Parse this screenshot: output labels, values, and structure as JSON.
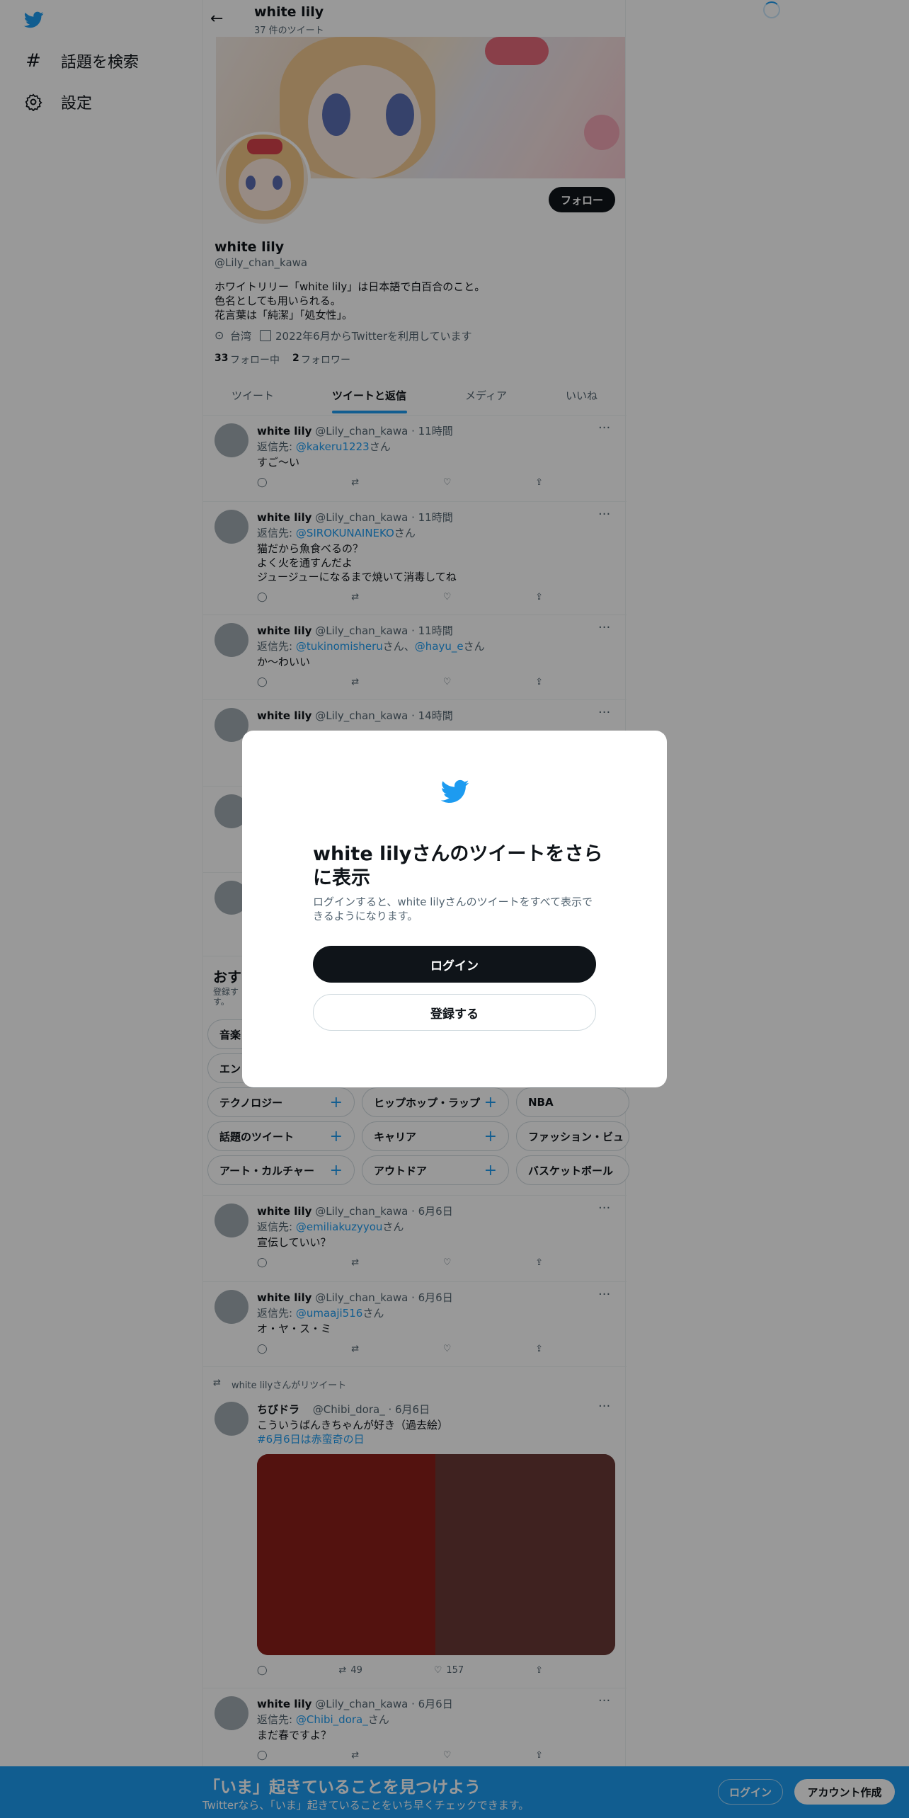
{
  "sidebar": {
    "items": [
      {
        "label": "話題を検索",
        "icon": "hash-icon"
      },
      {
        "label": "設定",
        "icon": "gear-icon"
      }
    ]
  },
  "header": {
    "name": "white lily",
    "count": "37 件のツイート"
  },
  "profile": {
    "name": "white lily",
    "handle": "@Lily_chan_kawa",
    "follow": "フォロー",
    "bio": [
      "ホワイトリリー「white lily」は日本語で白百合のこと。",
      "色名としても用いられる。",
      "花言葉は「純潔」「処女性」。"
    ],
    "location": "台湾",
    "joined": "2022年6月からTwitterを利用しています",
    "following_count": "33",
    "following_label": "フォロー中",
    "followers_count": "2",
    "followers_label": "フォロワー"
  },
  "tabs": [
    "ツイート",
    "ツイートと返信",
    "メディア",
    "いいね"
  ],
  "reply_prefix": "返信先:",
  "reply_suffix": "さん",
  "tweets": [
    {
      "name": "white lily",
      "meta": "@Lily_chan_kawa · 11時間",
      "reply_to": "@kakeru1223",
      "text": [
        "すご～い"
      ]
    },
    {
      "name": "white lily",
      "meta": "@Lily_chan_kawa · 11時間",
      "reply_to": "@SIROKUNAINEKO",
      "text": [
        "猫だから魚食べるの？",
        "よく火を通すんだよ",
        "ジュージューになるまで焼いて消毒してね"
      ]
    },
    {
      "name": "white lily",
      "meta": "@Lily_chan_kawa · 11時間",
      "reply_to": "@tukinomisheru",
      "reply_to2": "@hayu_e",
      "reply_mid": "さん、",
      "text": [
        "か～わいい"
      ]
    },
    {
      "name": "white lily",
      "meta": "@Lily_chan_kawa · 14時間"
    }
  ],
  "recommend": {
    "title": "おす",
    "subtitle1": "登録す",
    "subtitle2": "す。"
  },
  "chips": [
    "音楽",
    "エン",
    "テクノロジー",
    "ヒップホップ・ラップ",
    "NBA",
    "話題のツイート",
    "キャリア",
    "ファッション・ビュ",
    "アート・カルチャー",
    "アウトドア",
    "バスケットボール"
  ],
  "tweets2": [
    {
      "name": "white lily",
      "meta": "@Lily_chan_kawa · 6月6日",
      "reply_to": "@emiliakuzyyou",
      "text": [
        "宣伝していい？"
      ]
    },
    {
      "name": "white lily",
      "meta": "@Lily_chan_kawa · 6月6日",
      "reply_to": "@umaaji516",
      "text": [
        "オ・ヤ・ス・ミ"
      ]
    }
  ],
  "retweet": {
    "label": "white lilyさんがリツイート",
    "name": "ちびドラ",
    "meta": "@Chibi_dora_ · 6月6日",
    "text": "こういうばんきちゃんが好き（過去絵）",
    "hashtag": "#6月6日は赤蛮奇の日",
    "retweets": "49",
    "likes": "157"
  },
  "last_tweet": {
    "name": "white lily",
    "meta": "@Lily_chan_kawa · 6月6日",
    "reply_to": "@Chibi_dora_",
    "text": "まだ春ですよ？"
  },
  "modal": {
    "title": "white lilyさんのツイートをさらに表示",
    "body": "ログインすると、white lilyさんのツイートをすべて表示できるようになります。",
    "login": "ログイン",
    "signup": "登録する"
  },
  "banner": {
    "title": "「いま」起きていることを見つけよう",
    "sub": "Twitterなら、「いま」起きていることをいち早くチェックできます。",
    "login": "ログイン",
    "signup": "アカウント作成"
  },
  "colors": {
    "accent": "#1d9bf0",
    "dark": "#0f1419",
    "image_left": "#8a1e19",
    "image_right": "#6a3a36"
  }
}
